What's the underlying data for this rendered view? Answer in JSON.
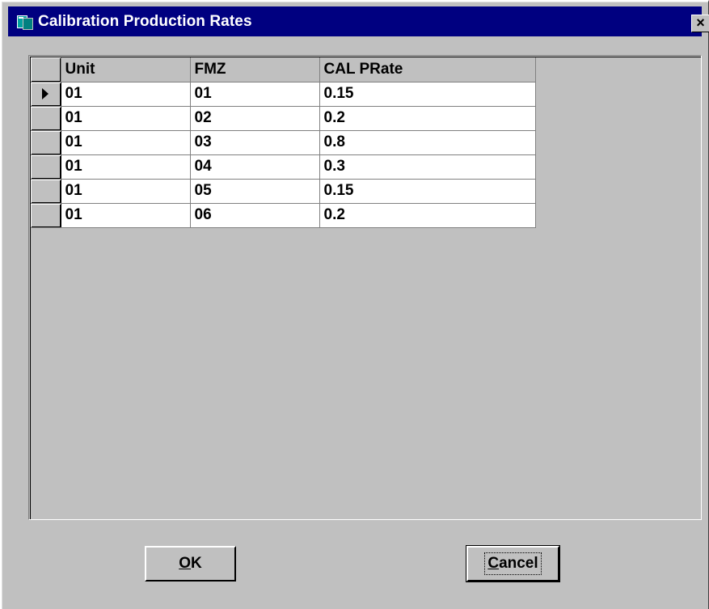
{
  "window": {
    "title": "Calibration Production Rates",
    "close_label": "×"
  },
  "grid": {
    "columns": [
      "Unit",
      "FMZ",
      "CAL PRate"
    ],
    "rows": [
      {
        "unit": "01",
        "fmz": "01",
        "rate": "0.15"
      },
      {
        "unit": "01",
        "fmz": "02",
        "rate": "0.2"
      },
      {
        "unit": "01",
        "fmz": "03",
        "rate": "0.8"
      },
      {
        "unit": "01",
        "fmz": "04",
        "rate": "0.3"
      },
      {
        "unit": "01",
        "fmz": "05",
        "rate": "0.15"
      },
      {
        "unit": "01",
        "fmz": "06",
        "rate": "0.2"
      }
    ]
  },
  "buttons": {
    "ok": {
      "mnemonic": "O",
      "rest": "K"
    },
    "cancel": {
      "mnemonic": "C",
      "rest": "ancel"
    }
  },
  "colors": {
    "titlebar": "#000080",
    "face": "#c0c0c0",
    "cell": "#ffffff"
  },
  "icons": {
    "app": "table-app-icon",
    "current_row": "row-pointer-arrow-icon",
    "close": "close-icon"
  }
}
